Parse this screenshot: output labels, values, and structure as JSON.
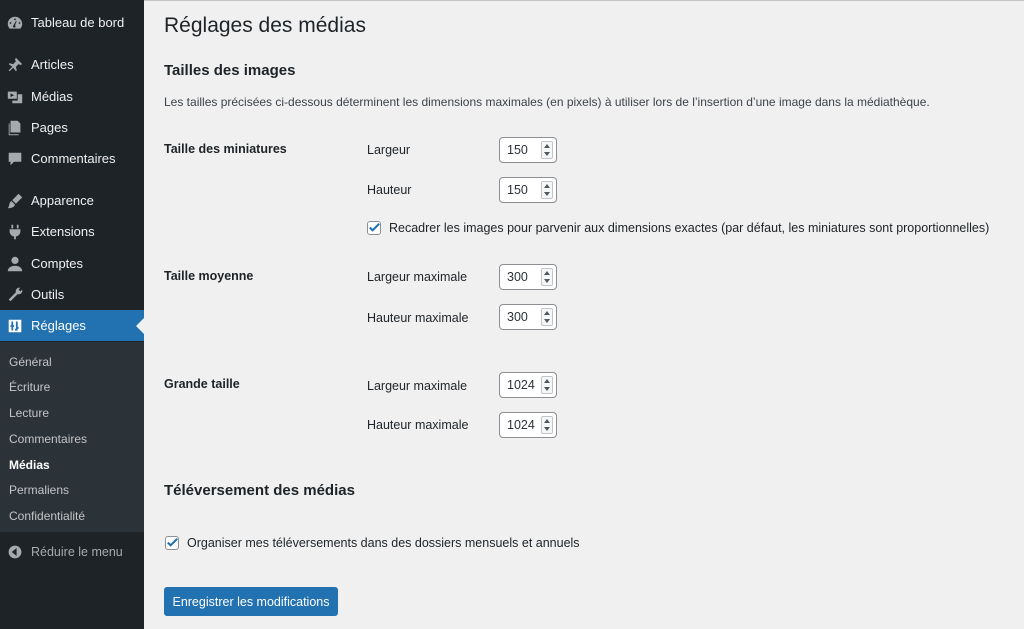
{
  "colors": {
    "sidebar_bg": "#1d2327",
    "submenu_bg": "#2c3338",
    "accent": "#2271b1",
    "page_bg": "#f0f0f1"
  },
  "sidebar": {
    "items": [
      {
        "label": "Tableau de bord",
        "icon": "dashboard-icon"
      },
      {
        "label": "Articles",
        "icon": "pin-icon"
      },
      {
        "label": "Médias",
        "icon": "media-icon"
      },
      {
        "label": "Pages",
        "icon": "pages-icon"
      },
      {
        "label": "Commentaires",
        "icon": "comments-icon"
      },
      {
        "label": "Apparence",
        "icon": "appearance-icon"
      },
      {
        "label": "Extensions",
        "icon": "plugins-icon"
      },
      {
        "label": "Comptes",
        "icon": "users-icon"
      },
      {
        "label": "Outils",
        "icon": "tools-icon"
      },
      {
        "label": "Réglages",
        "icon": "settings-icon",
        "active": true
      }
    ],
    "submenu": [
      "Général",
      "Écriture",
      "Lecture",
      "Commentaires",
      "Médias",
      "Permaliens",
      "Confidentialité"
    ],
    "submenu_current": "Médias",
    "collapse_label": "Réduire le menu"
  },
  "page": {
    "title": "Réglages des médias",
    "image_sizes": {
      "heading": "Tailles des images",
      "description": "Les tailles précisées ci-dessous déterminent les dimensions maximales (en pixels) à utiliser lors de l’insertion d’une image dans la médiathèque.",
      "thumbnail": {
        "label": "Taille des miniatures",
        "width_label": "Largeur",
        "width_value": "150",
        "height_label": "Hauteur",
        "height_value": "150",
        "crop_checked": true,
        "crop_label": "Recadrer les images pour parvenir aux dimensions exactes (par défaut, les miniatures sont proportionnelles)"
      },
      "medium": {
        "label": "Taille moyenne",
        "width_label": "Largeur maximale",
        "width_value": "300",
        "height_label": "Hauteur maximale",
        "height_value": "300"
      },
      "large": {
        "label": "Grande taille",
        "width_label": "Largeur maximale",
        "width_value": "1024",
        "height_label": "Hauteur maximale",
        "height_value": "1024"
      }
    },
    "uploads": {
      "heading": "Téléversement des médias",
      "organize_checked": true,
      "organize_label": "Organiser mes téléversements dans des dossiers mensuels et annuels"
    },
    "save_label": "Enregistrer les modifications"
  }
}
